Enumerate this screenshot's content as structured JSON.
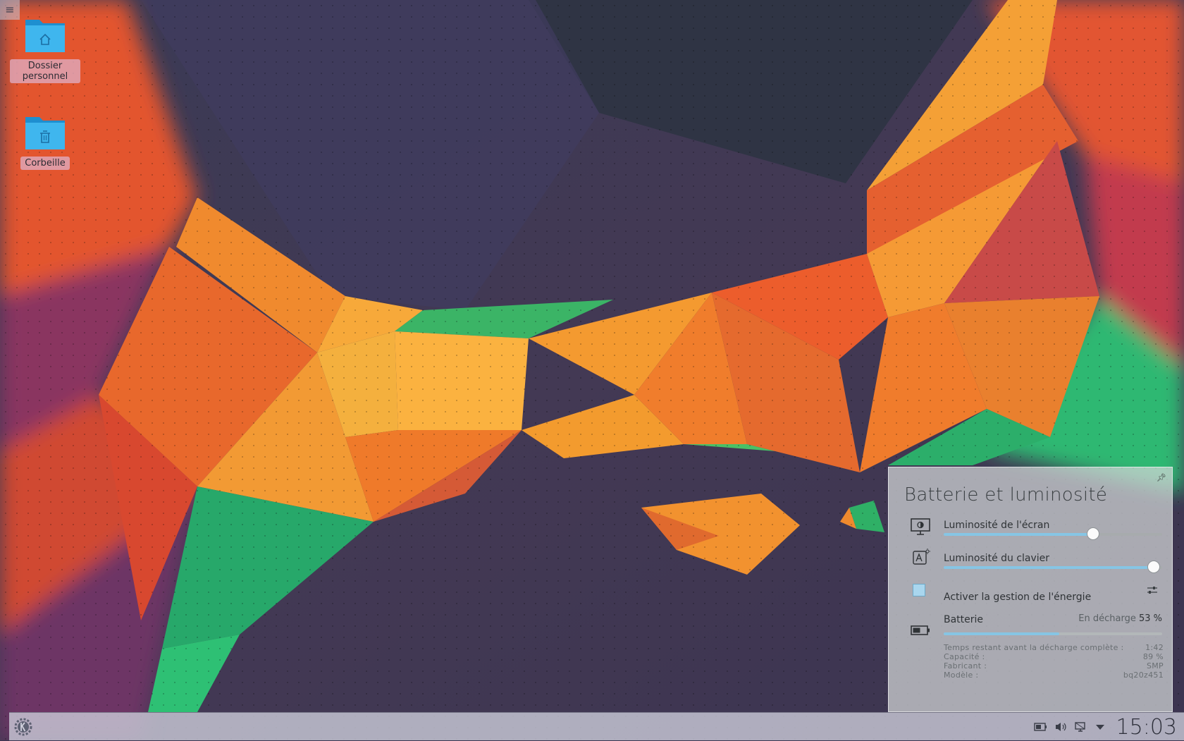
{
  "desktop": {
    "toolbox_icon": "hamburger-icon",
    "icons": [
      {
        "label": "Dossier personnel",
        "icon": "home-folder-icon"
      },
      {
        "label": "Corbeille",
        "icon": "trash-folder-icon"
      }
    ]
  },
  "battery_popup": {
    "title": "Batterie et luminosité",
    "pin_icon": "pin-icon",
    "screen_brightness": {
      "label": "Luminosité de l'écran",
      "level_fraction": 0.685,
      "icon": "monitor-brightness-icon"
    },
    "keyboard_brightness": {
      "label": "Luminosité du clavier",
      "level_fraction": 0.96,
      "icon": "keyboard-brightness-icon"
    },
    "power_management": {
      "label": "Activer la gestion de l'énergie",
      "checked": true,
      "settings_icon": "configure-icon"
    },
    "battery": {
      "label": "Batterie",
      "state": "En décharge",
      "percent": "53 %",
      "charge_fraction": 0.53,
      "icon": "battery-icon",
      "details": [
        {
          "key": "Temps restant avant la décharge complète :",
          "value": "1:42"
        },
        {
          "key": "Capacité :",
          "value": "89 %"
        },
        {
          "key": "Fabricant :",
          "value": "SMP"
        },
        {
          "key": "Modèle :",
          "value": "bq20z451"
        }
      ]
    }
  },
  "panel": {
    "launcher_icon": "kde-launcher-icon",
    "tray_icons": [
      "battery-tray-icon",
      "volume-icon",
      "network-icon",
      "expand-arrow-icon"
    ],
    "clock": "15:03"
  },
  "colors": {
    "accent": "#86c5e4",
    "panel_bg": "#c8c8d6"
  }
}
